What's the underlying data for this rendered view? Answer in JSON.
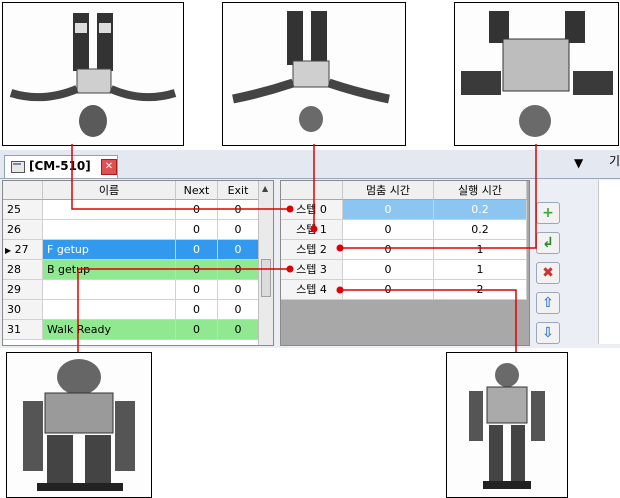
{
  "window": {
    "tab_title": "[CM-510]",
    "close_glyph": "✕",
    "dropdown_glyph": "▼",
    "side_text": "기"
  },
  "motion_list": {
    "headers": {
      "num": "",
      "name": "이름",
      "next": "Next",
      "exit": "Exit"
    },
    "rows": [
      {
        "num": "25",
        "name": "",
        "next": "0",
        "exit": "0",
        "selected": false,
        "green": false
      },
      {
        "num": "26",
        "name": "",
        "next": "0",
        "exit": "0",
        "selected": false,
        "green": false
      },
      {
        "num": "27",
        "name": "F getup",
        "next": "0",
        "exit": "0",
        "selected": true,
        "green": false
      },
      {
        "num": "28",
        "name": "B getup",
        "next": "0",
        "exit": "0",
        "selected": false,
        "green": true
      },
      {
        "num": "29",
        "name": "",
        "next": "0",
        "exit": "0",
        "selected": false,
        "green": false
      },
      {
        "num": "30",
        "name": "",
        "next": "0",
        "exit": "0",
        "selected": false,
        "green": false
      },
      {
        "num": "31",
        "name": "Walk Ready",
        "next": "0",
        "exit": "0",
        "selected": false,
        "green": true
      }
    ]
  },
  "step_list": {
    "headers": {
      "step": "",
      "pause": "멈춤 시간",
      "exec": "실행 시간"
    },
    "rows": [
      {
        "step": "스텝 0",
        "pause": "0",
        "exec": "0.2",
        "selected": true
      },
      {
        "step": "스텝 1",
        "pause": "0",
        "exec": "0.2",
        "selected": false
      },
      {
        "step": "스텝 2",
        "pause": "0",
        "exec": "1",
        "selected": false
      },
      {
        "step": "스텝 3",
        "pause": "0",
        "exec": "1",
        "selected": false
      },
      {
        "step": "스텝 4",
        "pause": "0",
        "exec": "2",
        "selected": false
      }
    ]
  },
  "side_buttons": [
    {
      "icon": "add-icon",
      "glyph": "+",
      "color": "#3aa83a"
    },
    {
      "icon": "insert-icon",
      "glyph": "↲",
      "color": "#2a8a2a"
    },
    {
      "icon": "delete-icon",
      "glyph": "✖",
      "color": "#d03030"
    },
    {
      "icon": "move-up-icon",
      "glyph": "⇧",
      "color": "#3a7ad0"
    },
    {
      "icon": "move-down-icon",
      "glyph": "⇩",
      "color": "#3a7ad0"
    }
  ],
  "colors": {
    "selected_row": "#3399ee",
    "green_row": "#90e890",
    "step_selected": "#8cc6f0",
    "connector": "#e00000"
  },
  "photos": [
    {
      "name": "robot-photo-step0"
    },
    {
      "name": "robot-photo-step1"
    },
    {
      "name": "robot-photo-step2"
    },
    {
      "name": "robot-photo-step3"
    },
    {
      "name": "robot-photo-step4"
    }
  ]
}
